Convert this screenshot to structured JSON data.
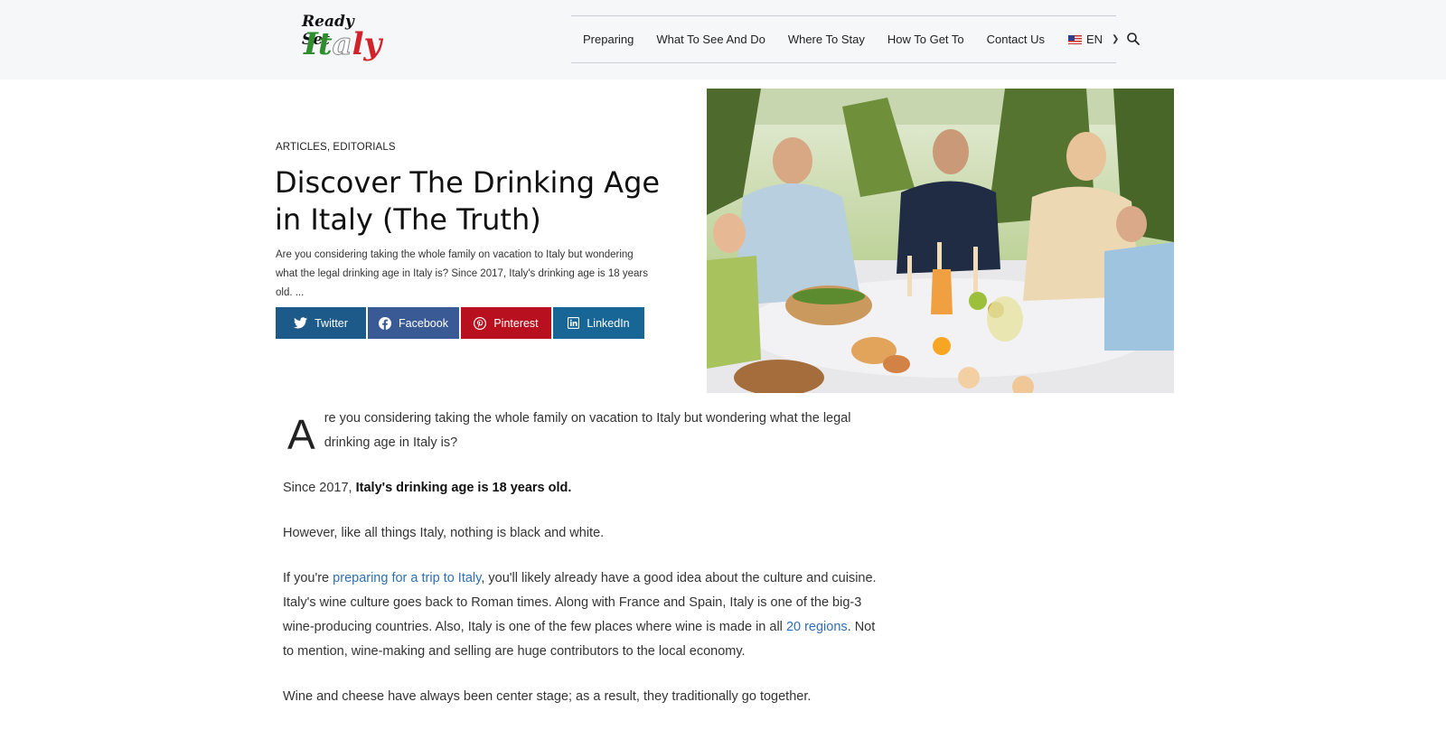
{
  "site": {
    "logo_line1": "Ready Set",
    "logo_line2_a": "It",
    "logo_line2_b": "a",
    "logo_line2_c": "ly"
  },
  "nav": {
    "items": [
      {
        "label": "Preparing"
      },
      {
        "label": "What To See And Do"
      },
      {
        "label": "Where To Stay"
      },
      {
        "label": "How To Get To"
      },
      {
        "label": "Contact Us"
      }
    ],
    "language": "EN",
    "search_icon": "search-icon"
  },
  "article": {
    "categories": "ARTICLES, EDITORIALS",
    "title": "Discover The Drinking Age in Italy (The Truth)",
    "excerpt": "Are you considering taking the whole family on vacation to Italy but wondering what the legal drinking age in Italy is? Since 2017, Italy's drinking age is 18 years old. ..."
  },
  "share": {
    "twitter": "Twitter",
    "facebook": "Facebook",
    "pinterest": "Pinterest",
    "linkedin": "LinkedIn"
  },
  "body": {
    "p1_dropcap": "A",
    "p1_rest": "re you considering taking the whole family on vacation to Italy but wondering what the legal drinking age in Italy is?",
    "p2_lead": "Since 2017,",
    "p2_bold": "Italy's drinking age is 18 years old.",
    "p3": "However, like all things Italy, nothing is black and white.",
    "p4_a": "If you're",
    "p4_link": "preparing for a trip to Italy",
    "p4_b": ", you'll likely already have a good idea about the culture and cuisine. Italy's wine culture goes back to Roman times. Along with France and Spain, Italy is one of the big-3 wine-producing countries. Also, Italy is one of the few places where wine is made in all",
    "p4_link2": "20 regions",
    "p4_c": ". Not to mention, wine-making and selling are huge contributors to the local economy.",
    "p5": "Wine and cheese have always been center stage; as a result, they traditionally go together."
  },
  "colors": {
    "twitter": "#1d5a8a",
    "facebook": "#3a5a96",
    "pinterest": "#b8101e",
    "linkedin": "#176696",
    "link": "#2e6fb4"
  }
}
